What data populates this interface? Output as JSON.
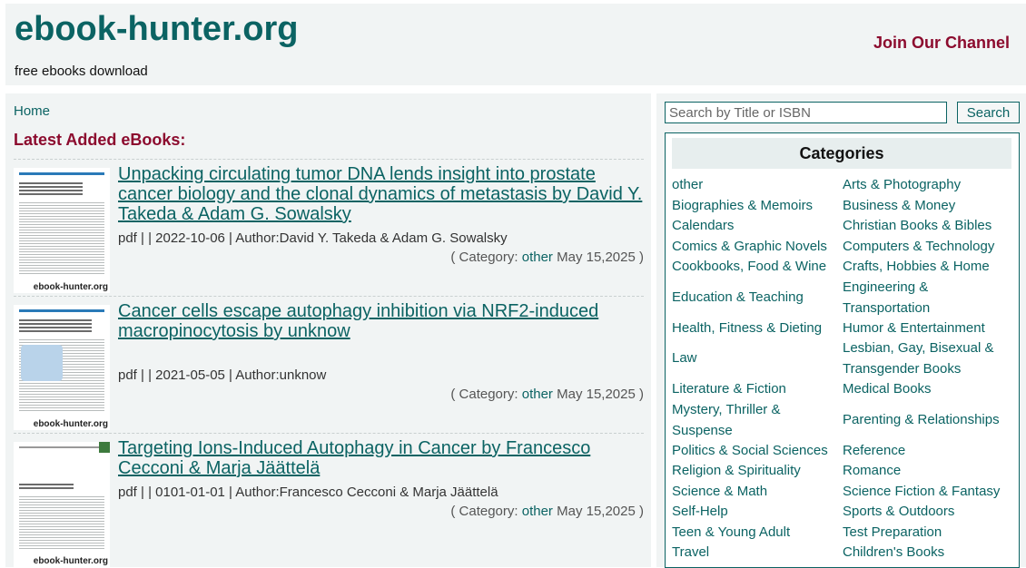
{
  "header": {
    "site_title": "ebook-hunter.org",
    "tagline": "free ebooks download",
    "join_link": "Join Our Channel"
  },
  "main": {
    "breadcrumb_home": "Home",
    "latest_heading": "Latest Added eBooks:",
    "books": [
      {
        "title": "Unpacking circulating tumor DNA lends insight into prostate cancer biology and the clonal dynamics of metastasis by David Y. Takeda & Adam G. Sowalsky",
        "meta": "pdf | | 2022-10-06 | Author:David Y. Takeda & Adam G. Sowalsky",
        "category_prefix": "( Category:",
        "category": "other",
        "date_suffix": "May 15,2025 )",
        "cover_watermark": "ebook-hunter.org"
      },
      {
        "title": "Cancer cells escape autophagy inhibition via NRF2-induced macropinocytosis by unknow",
        "meta": "pdf | | 2021-05-05 | Author:unknow",
        "category_prefix": "( Category:",
        "category": "other",
        "date_suffix": "May 15,2025 )",
        "cover_watermark": "ebook-hunter.org"
      },
      {
        "title": "Targeting Ions-Induced Autophagy in Cancer by Francesco Cecconi & Marja Jäättelä",
        "meta": "pdf | | 0101-01-01 | Author:Francesco Cecconi & Marja Jäättelä",
        "category_prefix": "( Category:",
        "category": "other",
        "date_suffix": "May 15,2025 )",
        "cover_watermark": "ebook-hunter.org"
      }
    ]
  },
  "sidebar": {
    "search": {
      "placeholder": "Search by Title or ISBN",
      "button": "Search"
    },
    "categories_heading": "Categories",
    "categories_left": [
      "other",
      "Biographies & Memoirs",
      "Calendars",
      "Comics & Graphic Novels",
      "Cookbooks, Food & Wine",
      "Education & Teaching",
      "Health, Fitness & Dieting",
      "Law",
      "Literature & Fiction",
      "Mystery, Thriller & Suspense",
      "Politics & Social Sciences",
      "Religion & Spirituality",
      "Science & Math",
      "Self-Help",
      "Teen & Young Adult",
      "Travel"
    ],
    "categories_right": [
      "Arts & Photography",
      "Business & Money",
      "Christian Books & Bibles",
      "Computers & Technology",
      "Crafts, Hobbies & Home",
      "Engineering & Transportation",
      "Humor & Entertainment",
      "Lesbian, Gay, Bisexual & Transgender Books",
      "Medical Books",
      "Parenting & Relationships",
      "Reference",
      "Romance",
      "Science Fiction & Fantasy",
      "Sports & Outdoors",
      "Test Preparation",
      "Children's Books"
    ]
  },
  "colors": {
    "brand_teal": "#0b6363",
    "accent_maroon": "#8c0b2e",
    "panel_bg": "#f1f4f4"
  }
}
